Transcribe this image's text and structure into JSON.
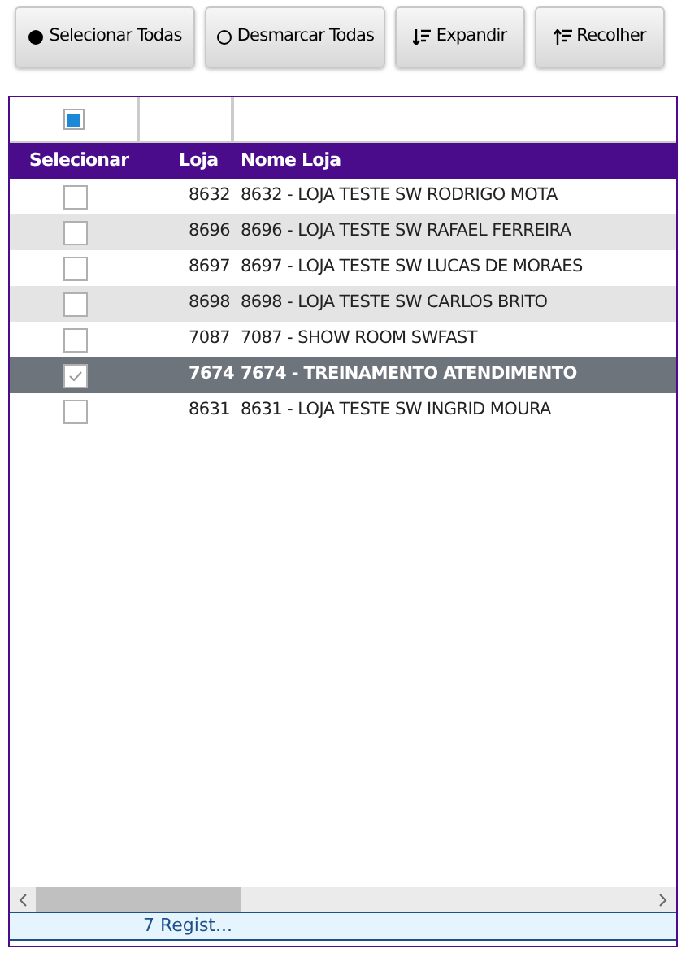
{
  "toolbar": [
    {
      "label": "Selecionar Todas",
      "kind": "filled-circle"
    },
    {
      "label": "Desmarcar Todas",
      "kind": "empty-circle"
    },
    {
      "label": "Expandir",
      "kind": "sort-down"
    },
    {
      "label": "Recolher",
      "kind": "sort-up"
    }
  ],
  "grid": {
    "select_all": {
      "indeterminate": true
    },
    "columns": [
      "Selecionar",
      "Loja",
      "Nome Loja"
    ],
    "rows": [
      {
        "loja": "8632",
        "nome": "8632 - LOJA TESTE SW RODRIGO MOTA",
        "selected": false
      },
      {
        "loja": "8696",
        "nome": "8696 - LOJA TESTE SW RAFAEL FERREIRA",
        "selected": false
      },
      {
        "loja": "8697",
        "nome": "8697 - LOJA TESTE SW LUCAS DE MORAES",
        "selected": false
      },
      {
        "loja": "8698",
        "nome": "8698 - LOJA TESTE SW CARLOS BRITO",
        "selected": false
      },
      {
        "loja": "7087",
        "nome": "7087 - SHOW ROOM SWFAST",
        "selected": false
      },
      {
        "loja": "7674",
        "nome": "7674 - TREINAMENTO ATENDIMENTO",
        "selected": true
      },
      {
        "loja": "8631",
        "nome": "8631 - LOJA TESTE SW INGRID MOURA",
        "selected": false
      }
    ],
    "footer": "7 Regist..."
  }
}
